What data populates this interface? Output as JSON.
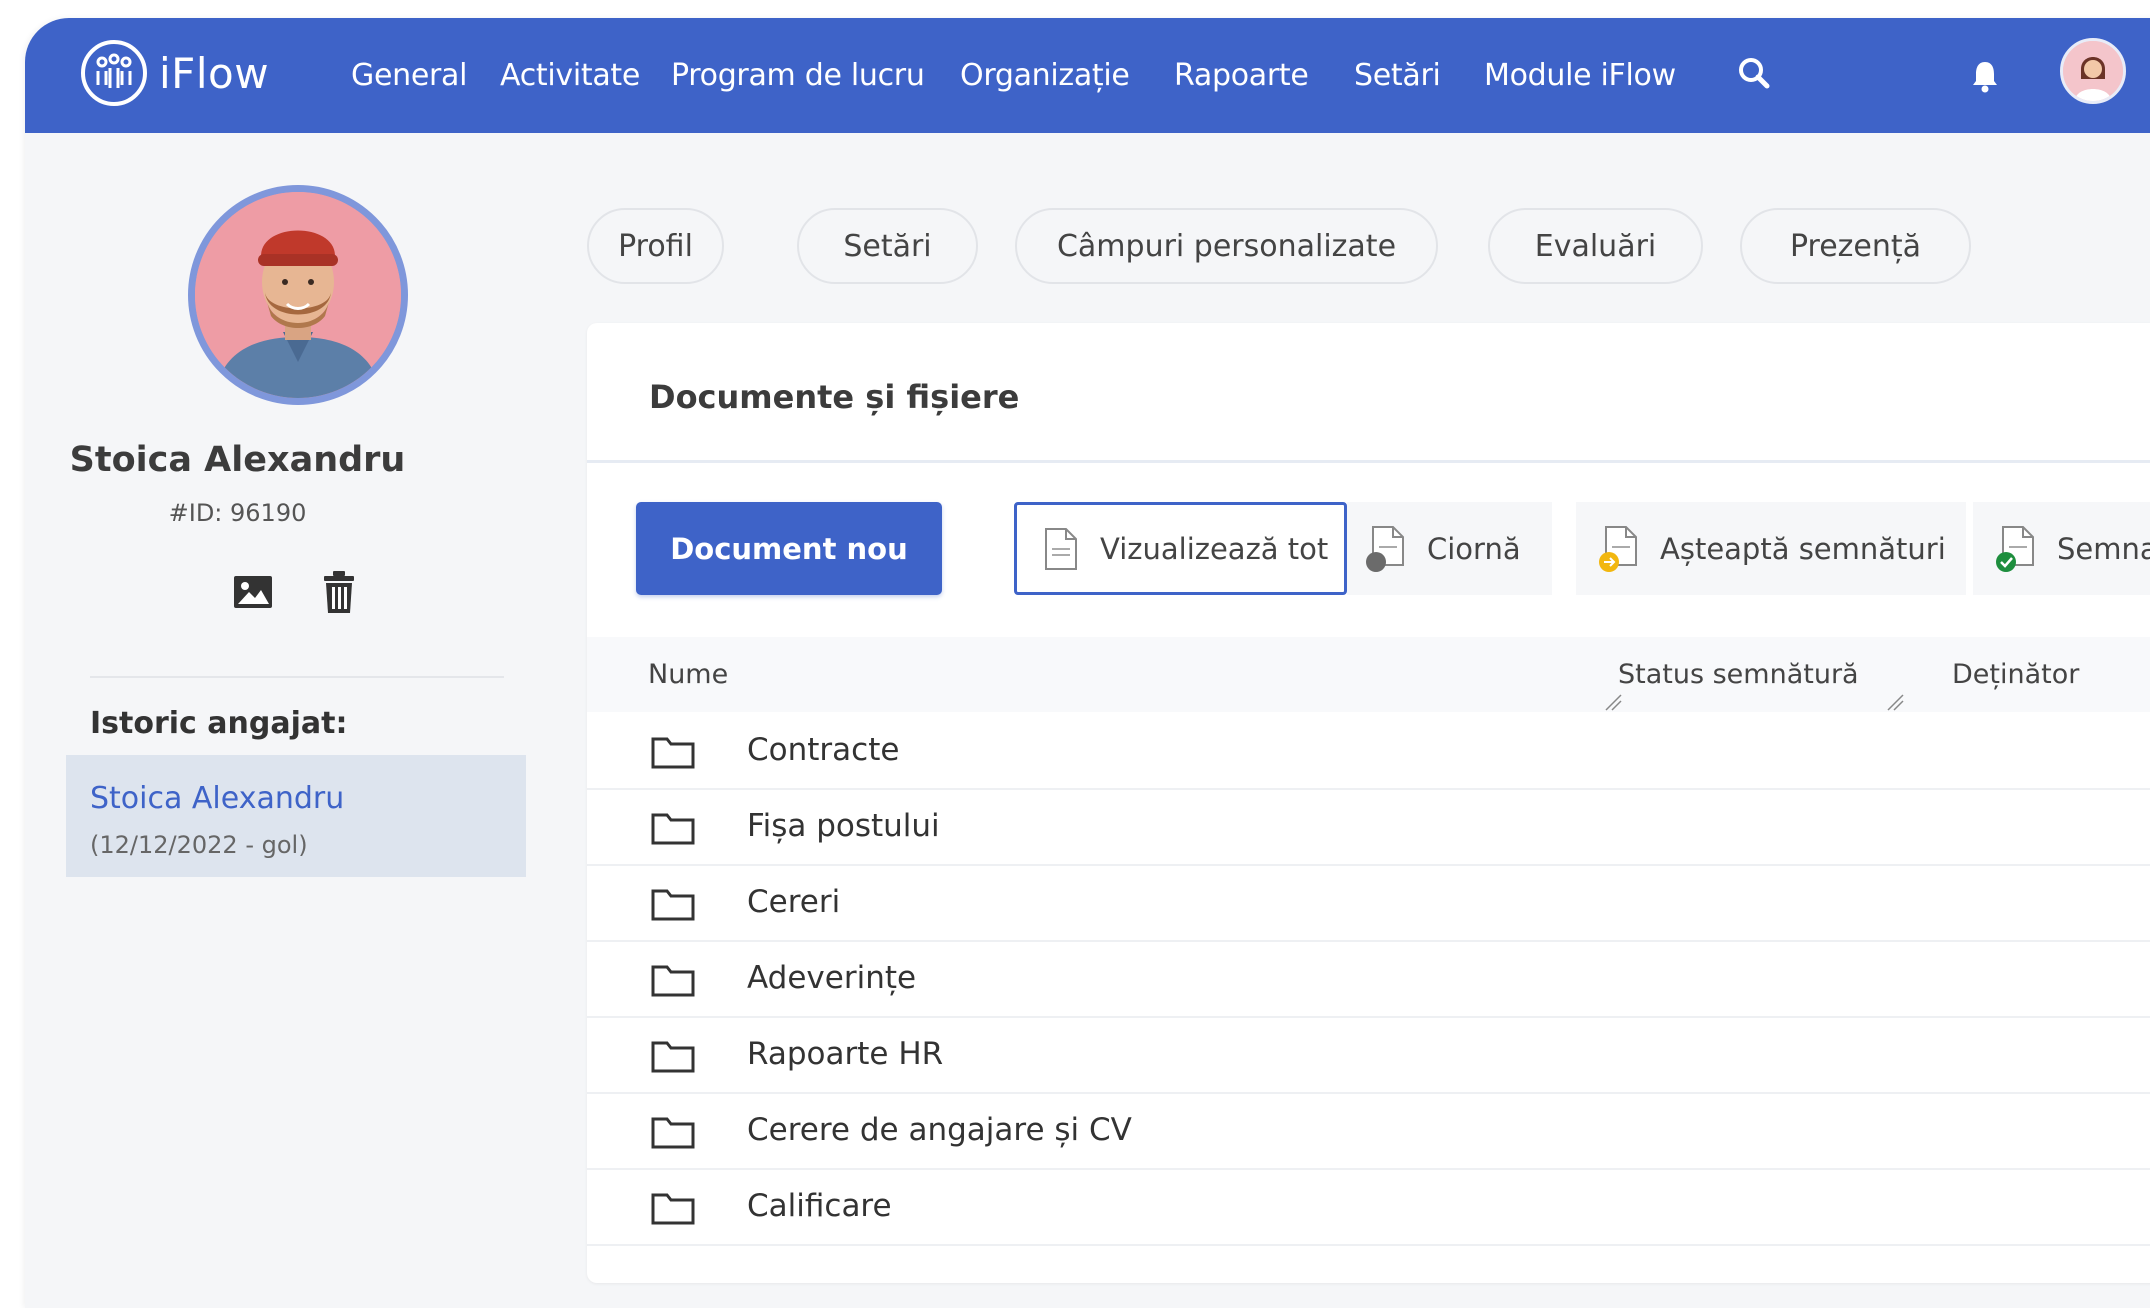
{
  "app": {
    "name": "iFlow"
  },
  "nav": {
    "items": [
      "General",
      "Activitate",
      "Program de lucru",
      "Organizație",
      "Rapoarte",
      "Setări",
      "Module iFlow"
    ]
  },
  "profile": {
    "name": "Stoica Alexandru",
    "id": "#ID: 96190"
  },
  "history": {
    "title": "Istoric angajat:",
    "name": "Stoica Alexandru",
    "date": "(12/12/2022 - gol)"
  },
  "tabs": [
    "Profil",
    "Setări",
    "Câmpuri personalizate",
    "Evaluări",
    "Prezență"
  ],
  "documents": {
    "title": "Documente și fișiere",
    "new_button": "Document nou",
    "filters": [
      "Vizualizează tot",
      "Ciornă",
      "Așteaptă semnături",
      "Semnat"
    ],
    "columns": {
      "name": "Nume",
      "status": "Status semnătură",
      "owner": "Deținător"
    },
    "folders": [
      "Contracte",
      "Fișa postului",
      "Cereri",
      "Adeverințe",
      "Rapoarte HR",
      "Cerere de angajare și CV",
      "Calificare"
    ]
  },
  "colors": {
    "brand": "#3e63c8",
    "brand_light": "#7f97db",
    "history_bg": "#dde4ee"
  }
}
